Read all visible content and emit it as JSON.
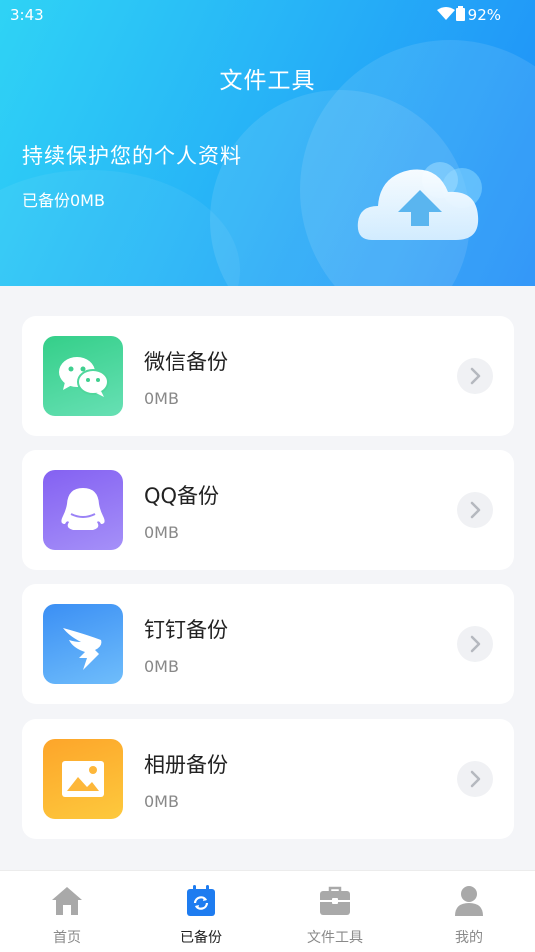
{
  "status": {
    "time": "3:43",
    "battery": "92%"
  },
  "header": {
    "title": "文件工具",
    "headline": "持续保护您的个人资料",
    "backed_up": "已备份0MB",
    "gradient": [
      "#2fd3f5",
      "#1e8cf8"
    ]
  },
  "cards": [
    {
      "name": "微信备份",
      "size": "0MB",
      "icon": "wechat-icon",
      "color": "#3fd394"
    },
    {
      "name": "QQ备份",
      "size": "0MB",
      "icon": "qq-icon",
      "color": "#8a6cf5"
    },
    {
      "name": "钉钉备份",
      "size": "0MB",
      "icon": "dingtalk-icon",
      "color": "#3a96f5"
    },
    {
      "name": "相册备份",
      "size": "0MB",
      "icon": "album-icon",
      "color": "#fdb52b"
    }
  ],
  "tabs": [
    {
      "label": "首页",
      "icon": "home-icon",
      "active": false
    },
    {
      "label": "已备份",
      "icon": "backup-calendar-icon",
      "active": true
    },
    {
      "label": "文件工具",
      "icon": "toolbox-icon",
      "active": false
    },
    {
      "label": "我的",
      "icon": "user-icon",
      "active": false
    }
  ],
  "accent": "#1e7cf0"
}
